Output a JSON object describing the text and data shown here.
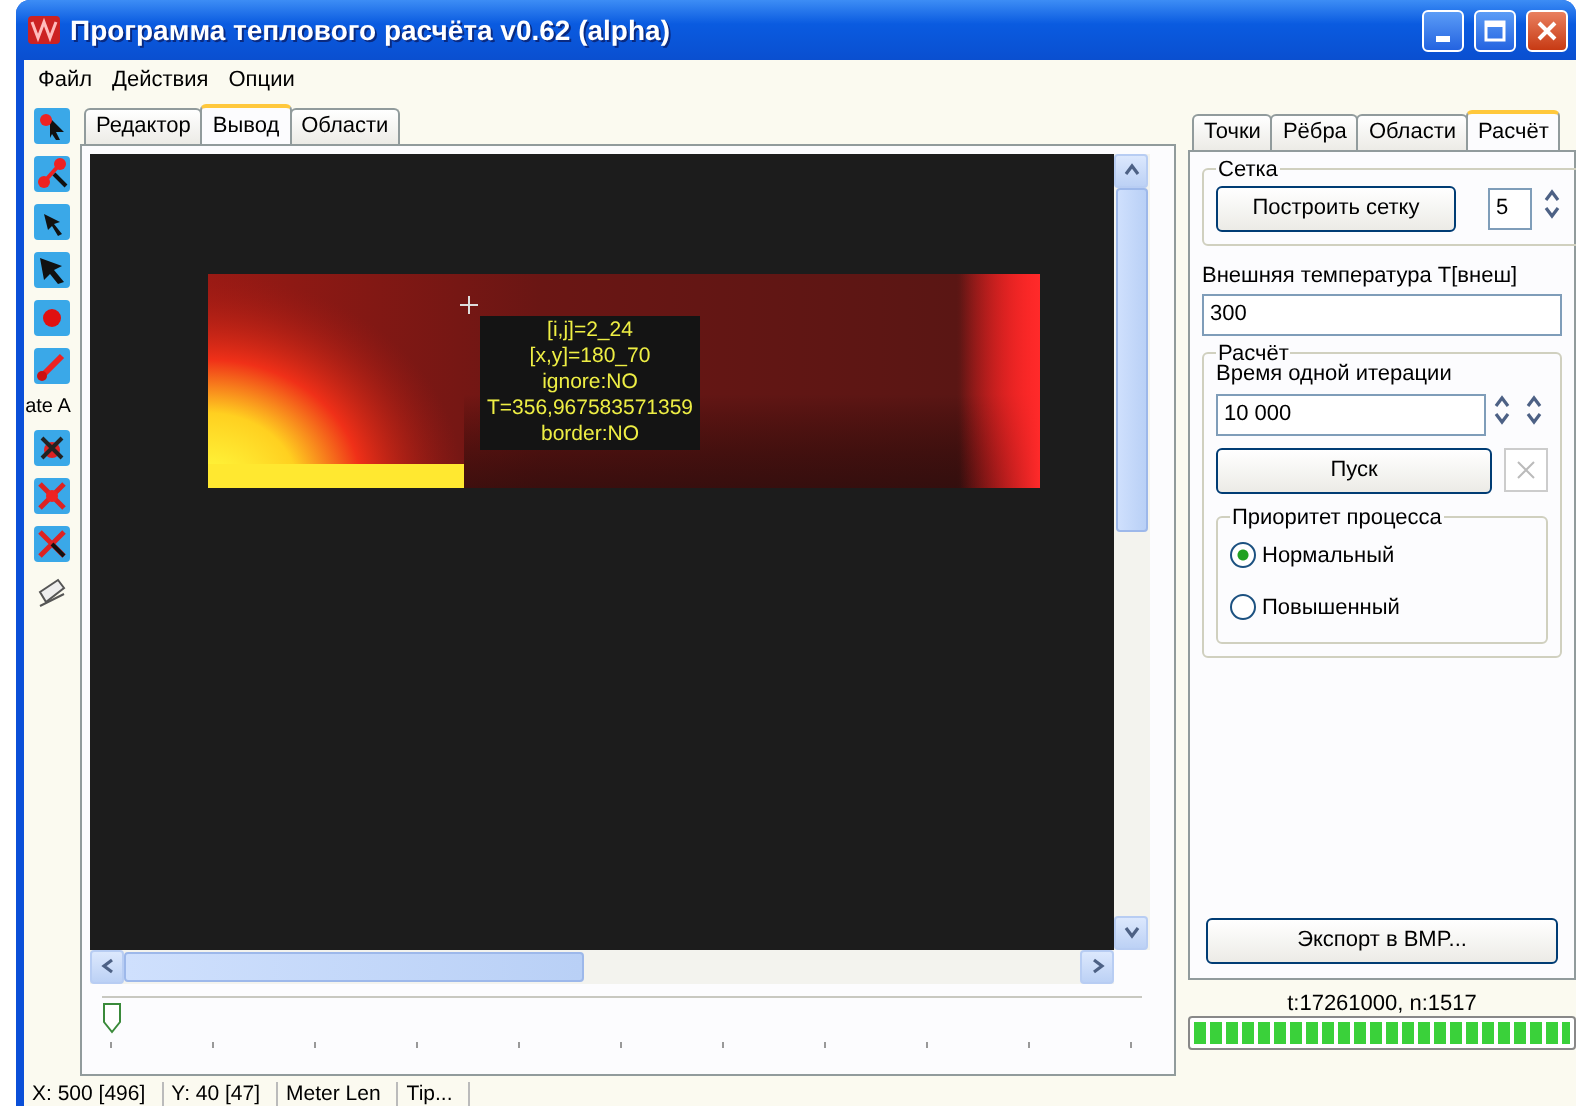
{
  "window": {
    "title": "Программа теплового расчёта v0.62 (alpha)"
  },
  "menu": [
    "Файл",
    "Действия",
    "Опции"
  ],
  "toolbar": {
    "label": "ate A"
  },
  "left_tabs": [
    {
      "label": "Редактор",
      "selected": false
    },
    {
      "label": "Вывод",
      "selected": true
    },
    {
      "label": "Области",
      "selected": false
    }
  ],
  "canvas": {
    "tooltip": [
      "[i,j]=2_24",
      "[x,y]=180_70",
      "ignore:NO",
      "T=356,967583571359",
      "border:NO"
    ]
  },
  "time_slider": {
    "level": 0
  },
  "right_tabs": [
    {
      "label": "Точки",
      "selected": false
    },
    {
      "label": "Рёбра",
      "selected": false
    },
    {
      "label": "Области",
      "selected": false
    },
    {
      "label": "Расчёт",
      "selected": true
    }
  ],
  "mesh_group": {
    "title": "Сетка",
    "build_button": "Построить сетку",
    "divisions": "5"
  },
  "outer_temp": {
    "label": "Внешняя температура T[внеш]",
    "value": "300"
  },
  "calc_group": {
    "title": "Расчёт",
    "iteration_label": "Время одной итерации",
    "iteration_value": "10 000",
    "start_button": "Пуск",
    "stop_disabled": true,
    "priority": {
      "title": "Приоритет процесса",
      "options": [
        {
          "label": "Нормальный",
          "selected": true
        },
        {
          "label": "Повышенный",
          "selected": false
        }
      ]
    }
  },
  "export_button": "Экспорт в BMP...",
  "progress": {
    "text": "t:17261000, n:1517",
    "level": 1
  },
  "status_bar": [
    "X: 500 [496]",
    "Y: 40 [47]",
    "Meter Len",
    "Tip..."
  ]
}
